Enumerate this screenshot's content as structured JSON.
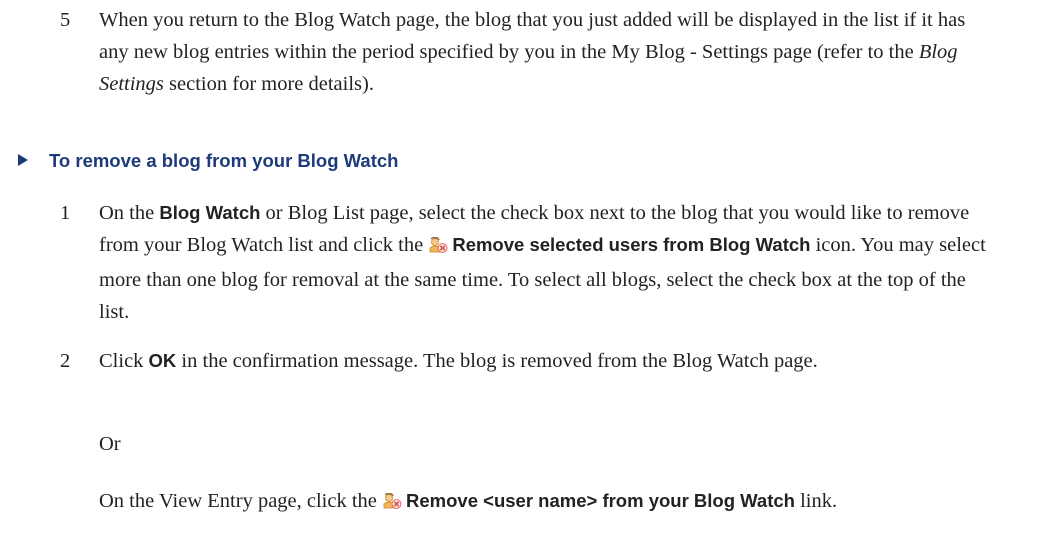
{
  "step5": {
    "num": "5",
    "text_a": "When you return to the Blog Watch page, the blog that you just added will be displayed in the list if it has any new blog entries within the period specified by you in the My Blog - Settings page (refer to the ",
    "text_em": "Blog Settings",
    "text_b": " section for more details)."
  },
  "procedure": {
    "heading": "To remove a blog from your Blog Watch"
  },
  "step1": {
    "num": "1",
    "t1": "On the ",
    "b1": "Blog Watch",
    "t2": " or Blog List page, select the check box next to the blog that you would like to remove from your Blog Watch list and click the ",
    "b2": "Remove selected users from Blog Watch",
    "t3": " icon. You may select more than one blog for removal at the same time. To select all blogs, select the check box at the top of the list."
  },
  "step2": {
    "num": "2",
    "t1": "Click ",
    "b1": "OK",
    "t2": " in the confirmation message. The blog is removed from the Blog Watch page."
  },
  "or_text": "Or",
  "alt": {
    "t1": "On the View Entry page, click the ",
    "b1": "Remove <user name> from your Blog Watch",
    "t2": " link."
  },
  "icons": {
    "remove": "remove-user-icon"
  }
}
